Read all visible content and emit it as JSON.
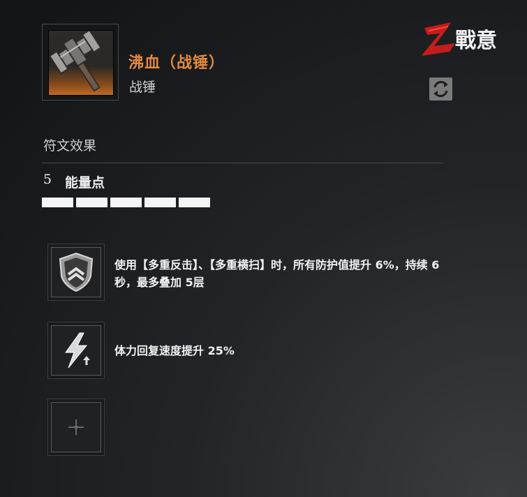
{
  "item": {
    "title": "沸血（战锤）",
    "subtitle": "战锤",
    "icon": "war-hammer-icon"
  },
  "logo": {
    "text": "戰意",
    "accent_color": "#d12020"
  },
  "swap_icon": "swap-arrows-icon",
  "section": {
    "title": "符文效果"
  },
  "energy": {
    "count": "5",
    "label": "能量点",
    "filled": 5,
    "total": 5
  },
  "effects": [
    {
      "icon": "shield-chevron-icon",
      "text": "使用【多重反击】、【多重横扫】时，所有防护值提升 6%，持续 6 秒，最多叠加 5层"
    },
    {
      "icon": "lightning-up-icon",
      "text": "体力回复速度提升 25%"
    },
    {
      "icon": "empty-slot-plus-icon",
      "text": ""
    }
  ],
  "colors": {
    "title_orange": "#e48a3c",
    "pip_white": "#f5f5f5"
  }
}
